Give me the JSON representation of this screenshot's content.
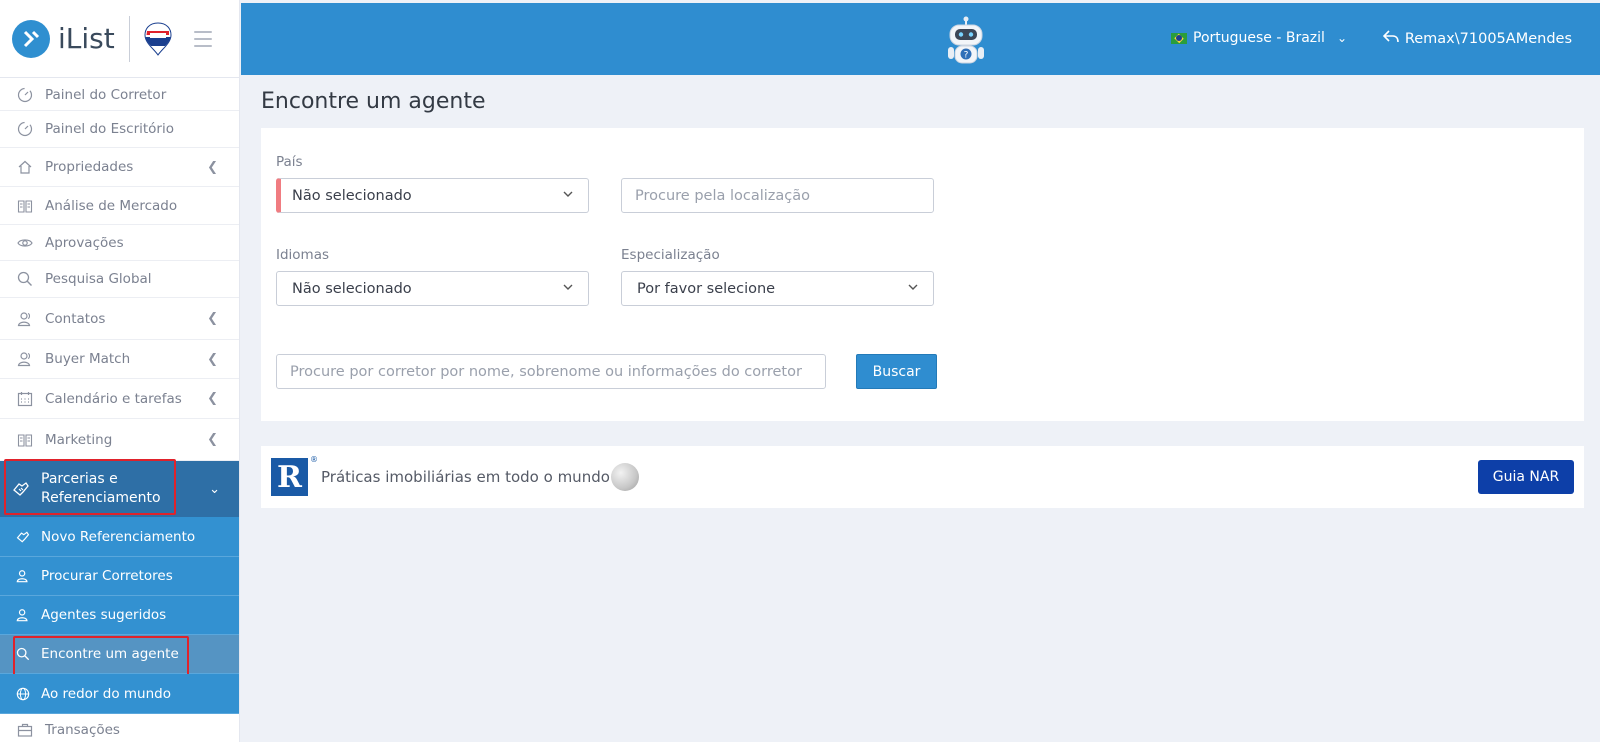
{
  "brand": {
    "name": "iList",
    "partner_badge": "RE/MAX"
  },
  "topbar": {
    "language": "Portuguese - Brazil",
    "user": "Remax\\71005AMendes"
  },
  "sidebar": {
    "items": [
      {
        "label": "Painel do Corretor",
        "icon": "dashboard-icon"
      },
      {
        "label": "Painel do Escritório",
        "icon": "dashboard-icon"
      },
      {
        "label": "Propriedades",
        "icon": "home-icon"
      },
      {
        "label": "Análise de Mercado",
        "icon": "book-icon"
      },
      {
        "label": "Aprovações",
        "icon": "eye-icon"
      },
      {
        "label": "Pesquisa Global",
        "icon": "search-icon"
      },
      {
        "label": "Contatos",
        "icon": "users-icon"
      },
      {
        "label": "Buyer Match",
        "icon": "users-icon"
      },
      {
        "label": "Calendário e tarefas",
        "icon": "calendar-icon"
      },
      {
        "label": "Marketing",
        "icon": "book-icon"
      }
    ],
    "open_parent": {
      "label_line1": "Parcerias e",
      "label_line2": "Referenciamento",
      "icon": "handshake-icon"
    },
    "sub_items": [
      {
        "label": "Novo Referenciamento",
        "icon": "handshake-icon"
      },
      {
        "label": "Procurar Corretores",
        "icon": "users-icon"
      },
      {
        "label": "Agentes sugeridos",
        "icon": "users-icon"
      },
      {
        "label": "Encontre um agente",
        "icon": "search-icon"
      },
      {
        "label": "Ao redor do mundo",
        "icon": "globe-icon"
      }
    ],
    "after_item": {
      "label": "Transações",
      "icon": "briefcase-icon"
    }
  },
  "main": {
    "title": "Encontre um agente",
    "form": {
      "country_label": "País",
      "country_value": "Não selecionado",
      "location_placeholder": "Procure pela localização",
      "languages_label": "Idiomas",
      "languages_value": "Não selecionado",
      "specialization_label": "Especialização",
      "specialization_value": "Por favor selecione",
      "agent_search_placeholder": "Procure por corretor por nome, sobrenome ou informações do corretor",
      "search_button": "Buscar"
    },
    "nar": {
      "text": "Práticas imobiliárias em todo o mundo",
      "button": "Guia NAR",
      "logo_letter": "R",
      "logo_reg": "®"
    }
  },
  "colors": {
    "accent": "#2f8dd0",
    "sidebar_open": "#2e6fa6",
    "nar_button": "#0d3fa8",
    "highlight": "#e0222b"
  }
}
